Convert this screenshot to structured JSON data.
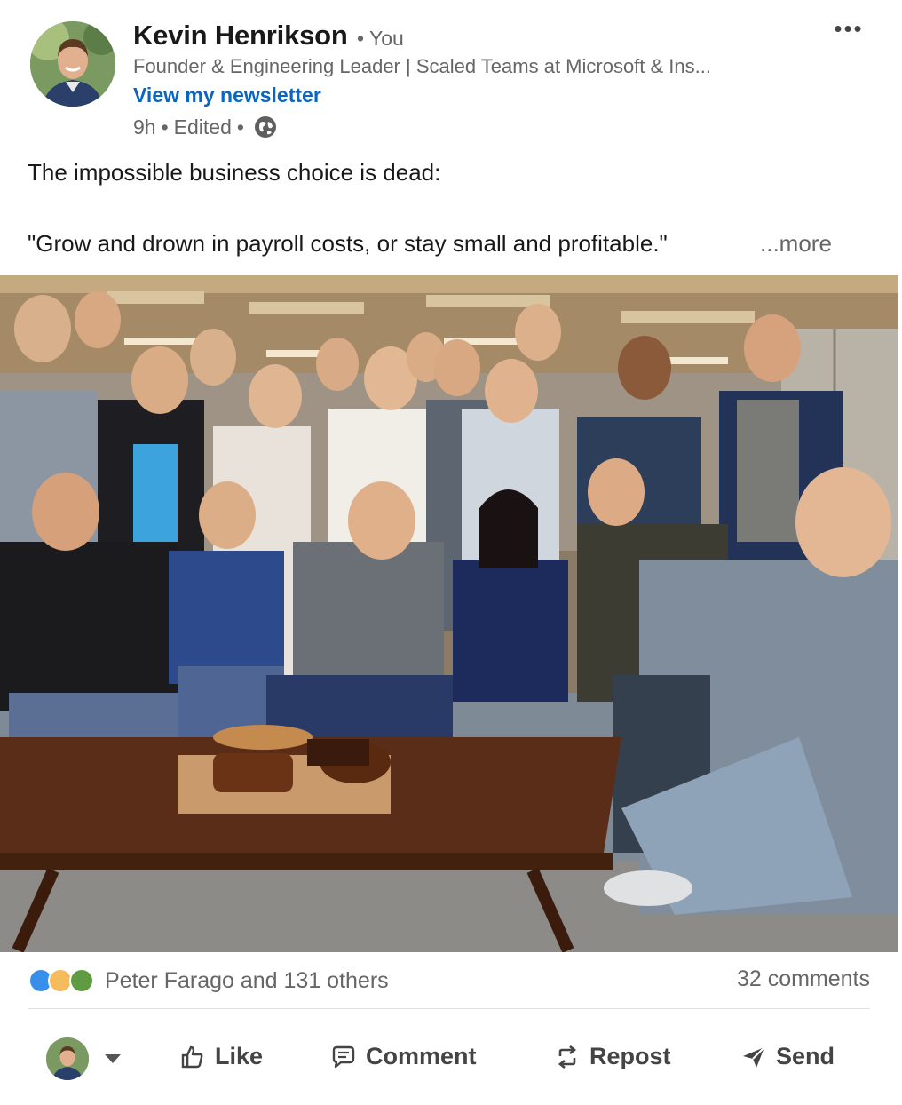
{
  "author": {
    "name": "Kevin Henrikson",
    "relation": "• You",
    "headline": "Founder & Engineering Leader | Scaled Teams at Microsoft & Ins...",
    "newsletter_link": "View my newsletter",
    "time": "9h",
    "edited": "Edited",
    "visibility_icon": "globe-icon"
  },
  "post": {
    "line1": "The impossible business choice is dead:",
    "line2": "\"Grow and drown in payroll costs, or stay small and profitable.\"",
    "see_more": "...more"
  },
  "social": {
    "reaction_icons": [
      "like-icon",
      "insightful-icon",
      "support-icon"
    ],
    "reactions_text": "Peter Farago and 131 others",
    "comments_text": "32 comments"
  },
  "actions": {
    "like": "Like",
    "comment": "Comment",
    "repost": "Repost",
    "send": "Send"
  },
  "colors": {
    "link_blue": "#0a66c2",
    "secondary_text": "#666666",
    "like_blue": "#378fe9"
  }
}
